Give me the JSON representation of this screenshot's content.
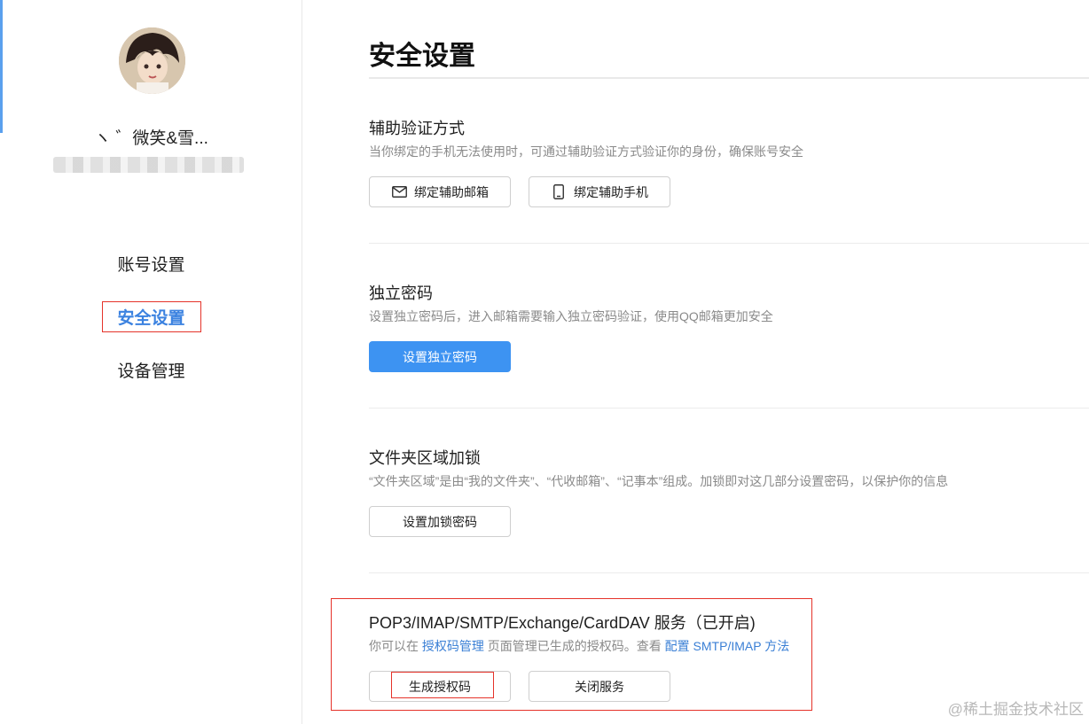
{
  "sidebar": {
    "username": "ヽ ゛微笑&雪...",
    "nav_items": [
      {
        "label": "账号设置",
        "active": false
      },
      {
        "label": "安全设置",
        "active": true
      },
      {
        "label": "设备管理",
        "active": false
      }
    ]
  },
  "main": {
    "page_title": "安全设置",
    "sections": [
      {
        "title": "辅助验证方式",
        "description": "当你绑定的手机无法使用时，可通过辅助验证方式验证你的身份，确保账号安全",
        "buttons": [
          {
            "label": "绑定辅助邮箱",
            "icon": "mail-icon"
          },
          {
            "label": "绑定辅助手机",
            "icon": "phone-icon"
          }
        ]
      },
      {
        "title": "独立密码",
        "description": "设置独立密码后，进入邮箱需要输入独立密码验证，使用QQ邮箱更加安全",
        "buttons": [
          {
            "label": "设置独立密码",
            "style": "primary"
          }
        ]
      },
      {
        "title": "文件夹区域加锁",
        "description": "“文件夹区域”是由“我的文件夹”、“代收邮箱”、“记事本”组成。加锁即对这几部分设置密码，以保护你的信息",
        "buttons": [
          {
            "label": "设置加锁密码"
          }
        ]
      },
      {
        "title": "POP3/IMAP/SMTP/Exchange/CardDAV 服务（已开启)",
        "description_parts": {
          "prefix": "你可以在 ",
          "link1": "授权码管理",
          "middle": " 页面管理已生成的授权码。查看 ",
          "link2": "配置 SMTP/IMAP 方法"
        },
        "buttons": [
          {
            "label": "生成授权码"
          },
          {
            "label": "关闭服务"
          }
        ]
      }
    ]
  },
  "watermark": "@稀土掘金技术社区",
  "colors": {
    "accent": "#3b82e0",
    "primary_button": "#3d93f2",
    "highlight_border": "#e5332a",
    "link": "#3a7fd5"
  }
}
